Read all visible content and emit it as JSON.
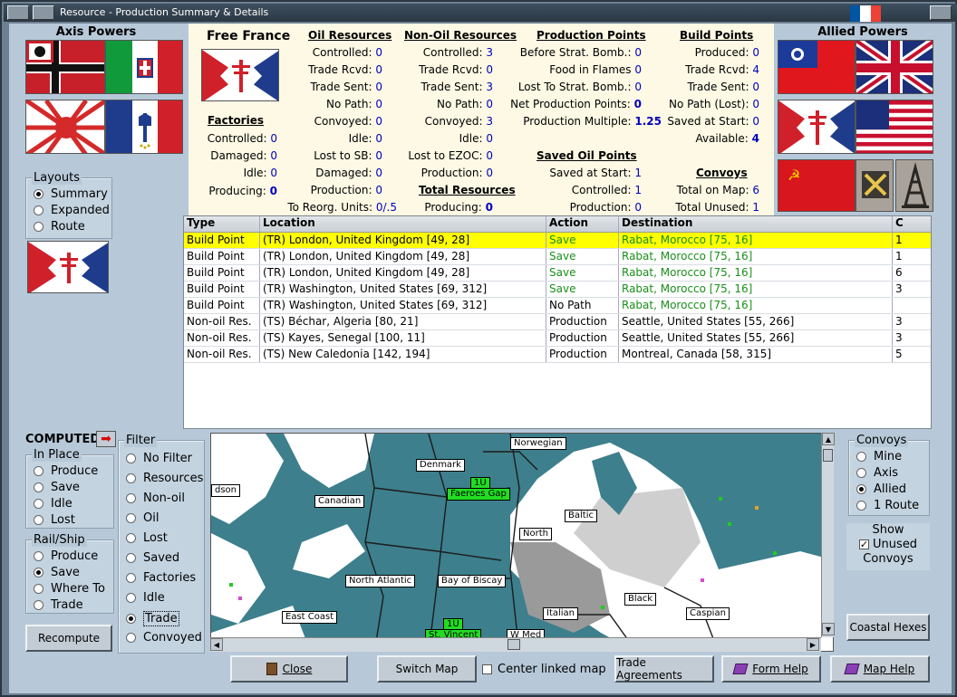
{
  "window": {
    "title": "Resource - Production Summary & Details"
  },
  "axis": {
    "title": "Axis Powers"
  },
  "allied": {
    "title": "Allied Powers"
  },
  "country": {
    "name": "Free France"
  },
  "layouts": {
    "title": "Layouts",
    "options": [
      "Summary",
      "Expanded",
      "Route"
    ],
    "selected": "Summary"
  },
  "computed": {
    "label": "COMPUTED"
  },
  "in_place": {
    "title": "In Place",
    "options": [
      "Produce",
      "Save",
      "Idle",
      "Lost"
    ],
    "selected": ""
  },
  "rail_ship": {
    "title": "Rail/Ship",
    "options": [
      "Produce",
      "Save",
      "Where To",
      "Trade"
    ],
    "selected": "Save"
  },
  "filter": {
    "title": "Filter",
    "options": [
      "No Filter",
      "Resources",
      "Non-oil",
      "Oil",
      "Lost",
      "Saved",
      "Factories",
      "Idle",
      "Trade",
      "Convoyed"
    ],
    "selected": "Trade"
  },
  "convoys_filter": {
    "title": "Convoys",
    "options": [
      "Mine",
      "Axis",
      "Allied",
      "1 Route"
    ],
    "selected": "Allied"
  },
  "show_unused": {
    "label_1": "Show",
    "label_2": "Unused",
    "label_3": "Convoys",
    "checked": true
  },
  "factories": {
    "title": "Factories",
    "rows": [
      {
        "label": "Controlled:",
        "value": "0"
      },
      {
        "label": "Damaged:",
        "value": "0"
      },
      {
        "label": "Idle:",
        "value": "0"
      },
      {
        "label": "Producing:",
        "value": "0"
      }
    ]
  },
  "oil": {
    "title": "Oil Resources",
    "rows": [
      {
        "label": "Controlled:",
        "value": "0"
      },
      {
        "label": "Trade Rcvd:",
        "value": "0"
      },
      {
        "label": "Trade Sent:",
        "value": "0"
      },
      {
        "label": "No Path:",
        "value": "0"
      },
      {
        "label": "Convoyed:",
        "value": "0"
      },
      {
        "label": "Idle:",
        "value": "0"
      },
      {
        "label": "Lost to SB:",
        "value": "0"
      },
      {
        "label": "Damaged:",
        "value": "0"
      },
      {
        "label": "Production:",
        "value": "0"
      },
      {
        "label": "To Reorg. Units:",
        "value": "0/.5"
      }
    ]
  },
  "nonoil": {
    "title": "Non-Oil Resources",
    "rows": [
      {
        "label": "Controlled:",
        "value": "3"
      },
      {
        "label": "Trade Rcvd:",
        "value": "0"
      },
      {
        "label": "Trade Sent:",
        "value": "3"
      },
      {
        "label": "No Path:",
        "value": "0"
      },
      {
        "label": "Convoyed:",
        "value": "3"
      },
      {
        "label": "Idle:",
        "value": "0"
      },
      {
        "label": "Lost to EZOC:",
        "value": "0"
      },
      {
        "label": "Production:",
        "value": "0"
      }
    ]
  },
  "total_resources": {
    "title": "Total Resources",
    "label": "Producing:",
    "value": "0"
  },
  "production_points": {
    "title": "Production Points",
    "rows": [
      {
        "label": "Before Strat. Bomb.:",
        "value": "0"
      },
      {
        "label": "Food in Flames",
        "value": "0"
      },
      {
        "label": "Lost To Strat. Bomb.:",
        "value": "0"
      },
      {
        "label": "Net Production Points:",
        "value": "0"
      },
      {
        "label": "Production Multiple:",
        "value": "1.25"
      }
    ]
  },
  "saved_oil": {
    "title": "Saved Oil Points",
    "rows": [
      {
        "label": "Saved at Start:",
        "value": "1"
      },
      {
        "label": "Controlled:",
        "value": "1"
      },
      {
        "label": "Production:",
        "value": "0"
      }
    ]
  },
  "build_points": {
    "title": "Build Points",
    "rows": [
      {
        "label": "Produced:",
        "value": "0"
      },
      {
        "label": "Trade Rcvd:",
        "value": "4"
      },
      {
        "label": "Trade Sent:",
        "value": "0"
      },
      {
        "label": "No Path (Lost):",
        "value": "0"
      },
      {
        "label": "Saved at Start:",
        "value": "0"
      },
      {
        "label": "Available:",
        "value": "4"
      }
    ]
  },
  "convoys": {
    "title": "Convoys",
    "rows": [
      {
        "label": "Total on Map:",
        "value": "6"
      },
      {
        "label": "Total Unused:",
        "value": "1"
      }
    ]
  },
  "table": {
    "headers": [
      "Type",
      "Location",
      "Action",
      "Destination",
      "C"
    ],
    "rows": [
      {
        "type": "Build Point",
        "location": "(TR) London, United Kingdom [49, 28]",
        "action": "Save",
        "destination": "Rabat, Morocco [75, 16]",
        "c": "1"
      },
      {
        "type": "Build Point",
        "location": "(TR) London, United Kingdom [49, 28]",
        "action": "Save",
        "destination": "Rabat, Morocco [75, 16]",
        "c": "1"
      },
      {
        "type": "Build Point",
        "location": "(TR) London, United Kingdom [49, 28]",
        "action": "Save",
        "destination": "Rabat, Morocco [75, 16]",
        "c": "6"
      },
      {
        "type": "Build Point",
        "location": "(TR) Washington, United States [69, 312]",
        "action": "Save",
        "destination": "Rabat, Morocco [75, 16]",
        "c": "3"
      },
      {
        "type": "Build Point",
        "location": "(TR) Washington, United States [69, 312]",
        "action": "No Path",
        "destination": "Rabat, Morocco [75, 16]",
        "c": ""
      },
      {
        "type": "Non-oil Res.",
        "location": "(TS) Béchar, Algeria [80, 21]",
        "action": "Production",
        "destination": "Seattle, United States [55, 266]",
        "c": "3"
      },
      {
        "type": "Non-oil Res.",
        "location": "(TS) Kayes, Senegal [100, 11]",
        "action": "Production",
        "destination": "Seattle, United States [55, 266]",
        "c": "3"
      },
      {
        "type": "Non-oil Res.",
        "location": "(TS) New Caledonia [142, 194]",
        "action": "Production",
        "destination": "Montreal, Canada [58, 315]",
        "c": "5"
      }
    ]
  },
  "map_labels": {
    "norwegian": "Norwegian",
    "denmark": "Denmark",
    "faeroes_num": "1U",
    "faeroes": "Faeroes Gap",
    "dson": "dson",
    "canadian": "Canadian",
    "baltic": "Baltic",
    "north": "North",
    "north_atlantic": "North Atlantic",
    "bay_of_biscay": "Bay of Biscay",
    "black": "Black",
    "east_coast": "East Coast",
    "italian": "Italian",
    "caspian": "Caspian",
    "stv_num": "1U",
    "st_vincent": "St. Vincent",
    "w_med": "W Med"
  },
  "buttons": {
    "recompute": "Recompute",
    "close": "Close",
    "switch_map": "Switch Map",
    "center_linked": "Center linked map",
    "trade_agreements": "Trade Agreements",
    "form_help": "Form Help",
    "map_help": "Map Help",
    "coastal_hexes": "Coastal Hexes"
  },
  "colors": {
    "sea": "#3d7f8c",
    "selected_row": "#ffff00",
    "value_blue": "#0000c0",
    "action_green": "#1a8f1a"
  }
}
